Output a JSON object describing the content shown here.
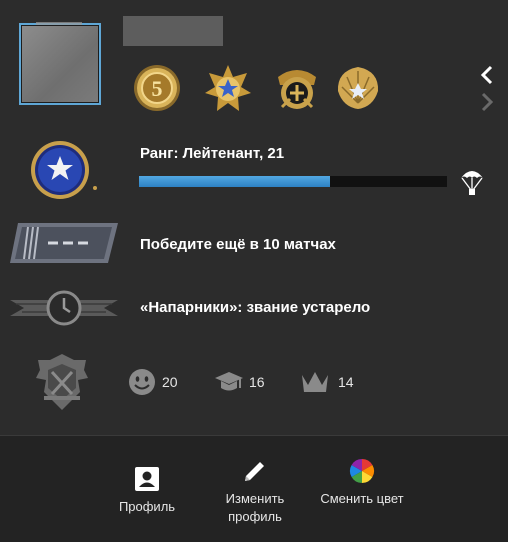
{
  "rank": {
    "title": "Ранг: Лейтенант, 21",
    "progress": 0.62
  },
  "competitive": {
    "text": "Победите ещё в 10 матчах"
  },
  "wingman": {
    "text": "«Напарники»: звание устарело"
  },
  "commendations": {
    "friendly": "20",
    "teacher": "16",
    "leader": "14"
  },
  "bottom": {
    "profile": "Профиль",
    "edit_profile": "Изменить профиль",
    "change_color": "Сменить цвет"
  },
  "colors": {
    "accent": "#3b93d3",
    "bg": "#2c2c2c",
    "gold": "#c9a24b"
  }
}
